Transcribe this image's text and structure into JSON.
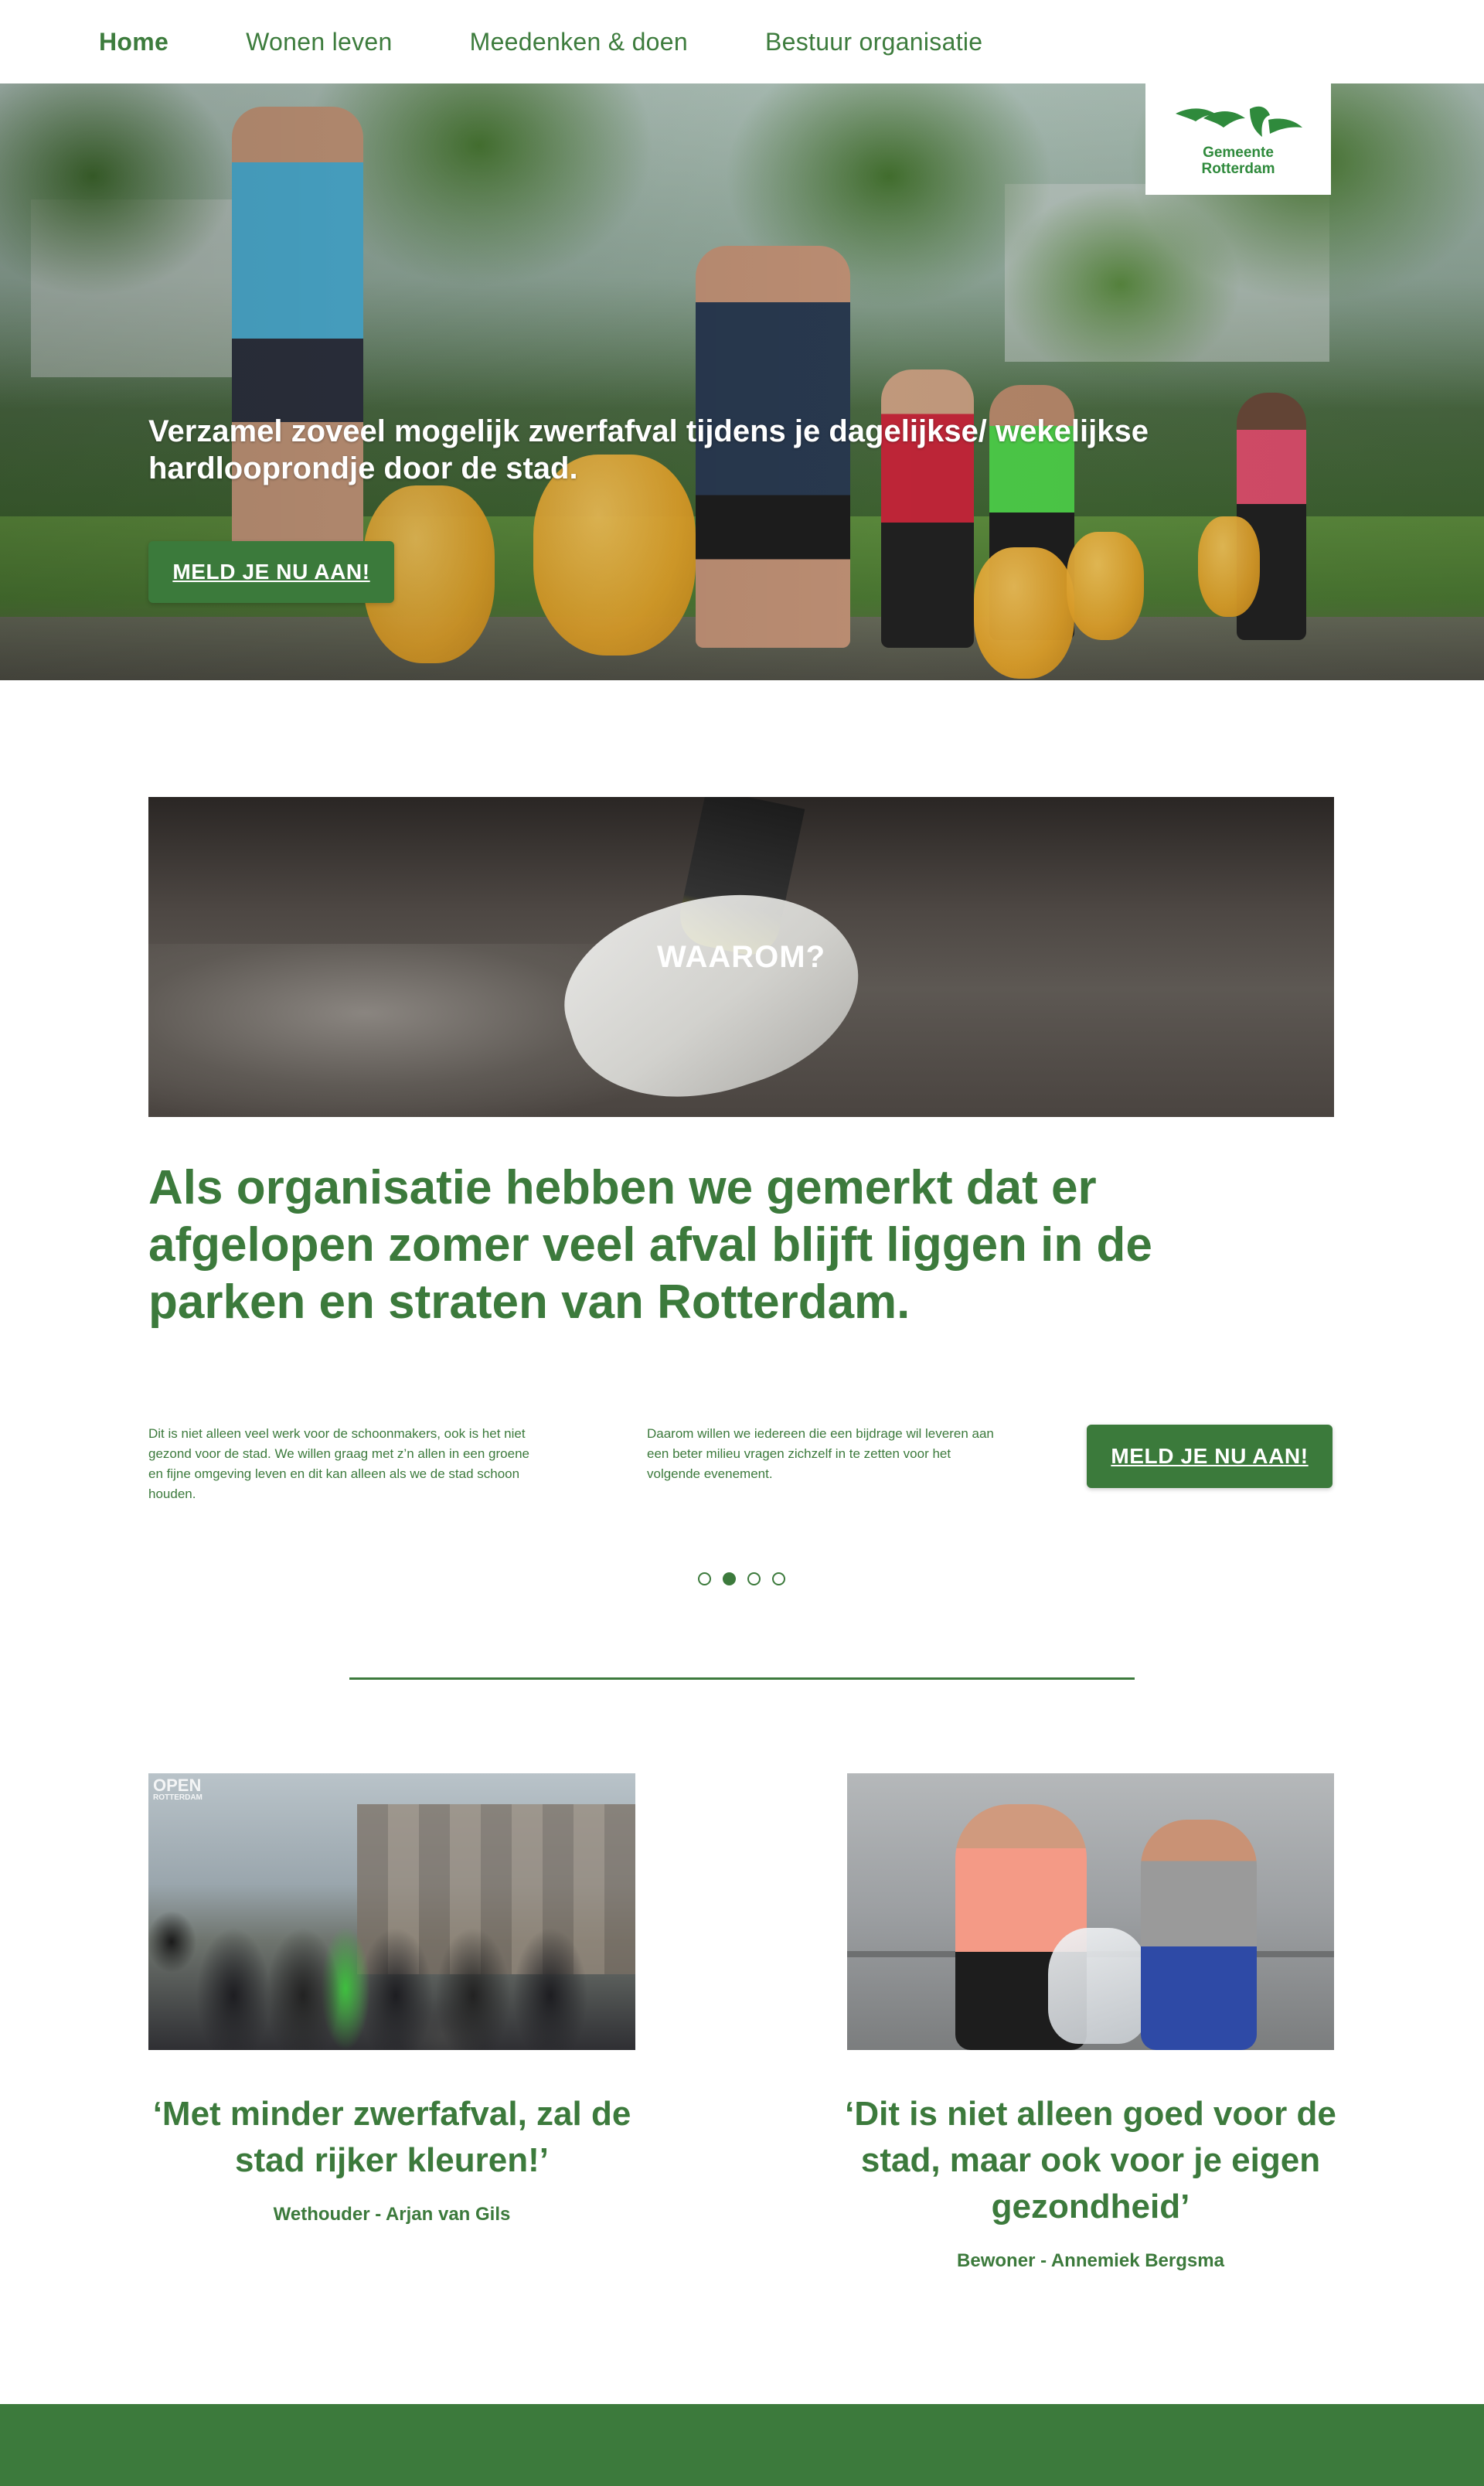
{
  "nav": {
    "items": [
      {
        "label": "Home",
        "active": true
      },
      {
        "label": "Wonen leven",
        "active": false
      },
      {
        "label": "Meedenken & doen",
        "active": false
      },
      {
        "label": "Bestuur organisatie",
        "active": false
      }
    ]
  },
  "logo": {
    "line1": "Gemeente",
    "line2": "Rotterdam",
    "icon": "rotterdam-lion-logo-icon"
  },
  "hero": {
    "title": "Verzamel zoveel mogelijk zwerfafval tijdens je dagelijkse/ wekelijkse hardlooprondje door de stad.",
    "button_label": "MELD JE NU AAN!"
  },
  "waarom": {
    "label": "WAAROM?",
    "heading": "Als organisatie hebben we gemerkt dat er afgelopen zomer veel afval blijft liggen in de parken en straten van Rotterdam.",
    "col1": "Dit is niet alleen veel werk voor de schoonmakers, ook is het niet gezond voor de stad. We willen graag met z’n allen in een groene en fijne omgeving leven en dit kan alleen als we de stad schoon houden.",
    "col2": "Daarom willen we iedereen die een bijdrage wil leveren aan een beter milieu vragen zichzelf in te zetten voor het volgende evenement.",
    "button_label": "MELD JE NU AAN!",
    "carousel": {
      "count": 4,
      "active_index": 1
    }
  },
  "testimonials": [
    {
      "quote": "‘Met minder zwerfafval, zal de stad rijker kleuren!’",
      "author": "Wethouder - Arjan van Gils",
      "badge": "OPEN",
      "badge_sub": "ROTTERDAM"
    },
    {
      "quote": "‘Dit is niet alleen goed voor de stad, maar ook voor je eigen gezondheid’",
      "author": "Bewoner - Annemiek Bergsma"
    }
  ],
  "colors": {
    "brand_green": "#3c7a3c",
    "logo_green": "#2f8a3c",
    "white": "#ffffff"
  }
}
